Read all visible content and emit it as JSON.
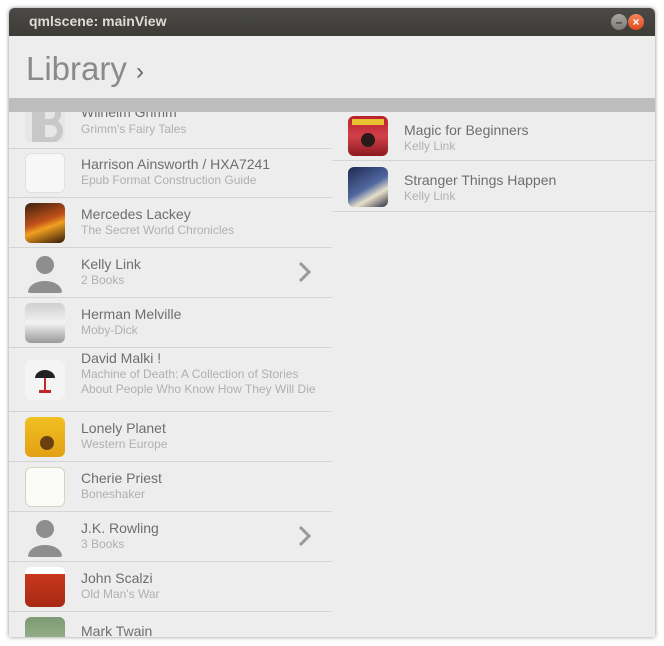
{
  "window": {
    "title": "qmlscene: mainView"
  },
  "header": {
    "title": "Library",
    "chevron": "›"
  },
  "authors": [
    {
      "name": "Wilhelm Grimm",
      "subtitle": "Grimm's Fairy Tales",
      "cover": "letter-B-cover"
    },
    {
      "name": "Harrison Ainsworth / HXA7241",
      "subtitle": "Epub Format Construction Guide",
      "cover": "blank-cover"
    },
    {
      "name": "Mercedes Lackey",
      "subtitle": "The Secret World Chronicles",
      "cover": "fire-cover"
    },
    {
      "name": "Kelly Link",
      "subtitle": "2 Books",
      "cover": "person-icon",
      "has_chevron": true
    },
    {
      "name": "Herman Melville",
      "subtitle": "Moby-Dick",
      "cover": "whale-cover"
    },
    {
      "name": "David Malki !",
      "subtitle": "Machine of Death: A Collection of Stories About People Who Know How They Will Die",
      "cover": "umbrella-cover"
    },
    {
      "name": "Lonely Planet",
      "subtitle": "Western Europe",
      "cover": "sunflower-cover"
    },
    {
      "name": "Cherie Priest",
      "subtitle": "Boneshaker",
      "cover": "white-cover"
    },
    {
      "name": "J.K. Rowling",
      "subtitle": "3 Books",
      "cover": "person-icon",
      "has_chevron": true
    },
    {
      "name": "John Scalzi",
      "subtitle": "Old Man's War",
      "cover": "red-cover"
    },
    {
      "name": "Mark Twain",
      "subtitle": "",
      "cover": "green-cover"
    }
  ],
  "books": [
    {
      "title": "Magic for Beginners",
      "author": "Kelly Link",
      "cover": "magic-cover"
    },
    {
      "title": "Stranger Things Happen",
      "author": "Kelly Link",
      "cover": "stranger-cover"
    }
  ],
  "colors": {
    "titlebar": "#3c3b37",
    "background": "#ededed",
    "divider": "#bdbdbd",
    "close": "#de4a1c"
  }
}
